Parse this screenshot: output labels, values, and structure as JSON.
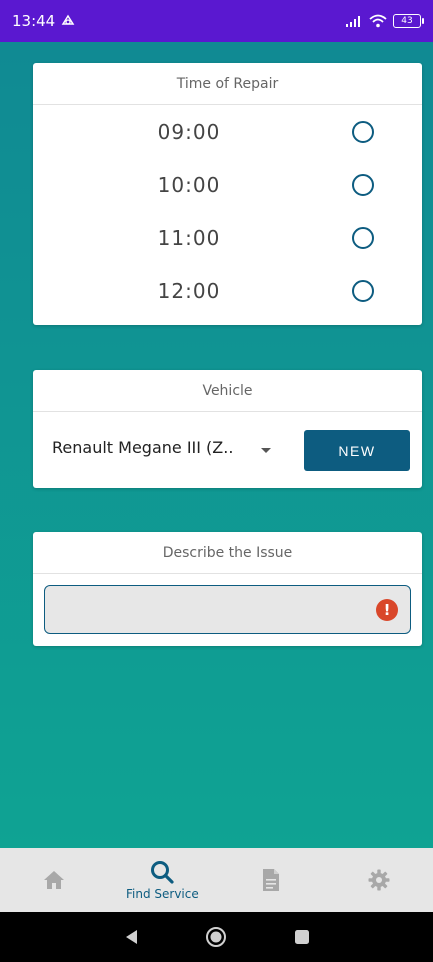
{
  "status_bar": {
    "time": "13:44",
    "battery": "43"
  },
  "time_card": {
    "title": "Time of Repair",
    "slots": [
      {
        "time": "09:00"
      },
      {
        "time": "10:00"
      },
      {
        "time": "11:00"
      },
      {
        "time": "12:00"
      }
    ]
  },
  "vehicle_card": {
    "title": "Vehicle",
    "selected_vehicle": "Renault Megane III (Z..",
    "new_label": "NEW"
  },
  "issue_card": {
    "title": "Describe the Issue",
    "value": "",
    "error_symbol": "!"
  },
  "bottom_nav": {
    "items": [
      {
        "icon": "home-icon",
        "label": ""
      },
      {
        "icon": "search-icon",
        "label": "Find Service"
      },
      {
        "icon": "document-icon",
        "label": ""
      },
      {
        "icon": "gear-icon",
        "label": ""
      }
    ],
    "active_index": 1
  },
  "colors": {
    "accent": "#0d5c80",
    "status_bar": "#5a18d0",
    "error": "#d9472a"
  }
}
